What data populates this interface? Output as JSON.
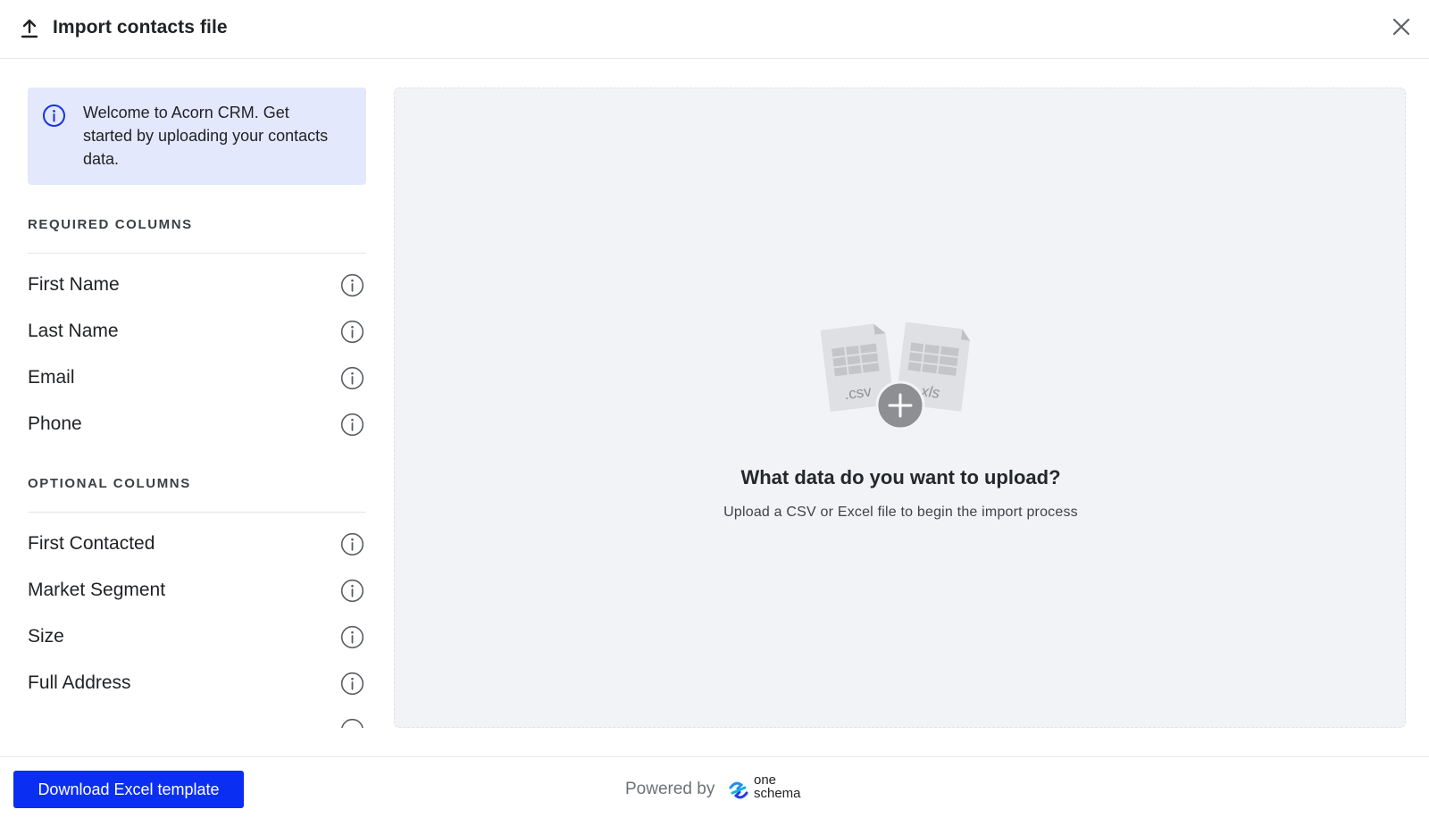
{
  "header": {
    "title": "Import contacts file",
    "icons": {
      "upload": "upload-icon",
      "close": "close-icon"
    }
  },
  "notice": {
    "text": "Welcome to Acorn CRM. Get started by uploading your contacts data.",
    "icon": "info-icon",
    "bg_color": "#e3e8fd",
    "icon_color": "#1733e0"
  },
  "required": {
    "label": "REQUIRED COLUMNS",
    "columns": [
      "First Name",
      "Last Name",
      "Email",
      "Phone"
    ]
  },
  "optional": {
    "label": "OPTIONAL COLUMNS",
    "columns": [
      "First Contacted",
      "Market Segment",
      "Size",
      "Full Address"
    ]
  },
  "dropzone": {
    "file_types": [
      ".csv",
      ".xls"
    ],
    "prompt": "What data do you want to upload?",
    "subtext": "Upload a CSV or Excel file to begin the import process",
    "icon": "add-file-icon"
  },
  "footer": {
    "download_label": "Download Excel template",
    "powered_by": "Powered by",
    "brand_line1": "one",
    "brand_line2": "schema",
    "button_color": "#0a2ff2"
  }
}
